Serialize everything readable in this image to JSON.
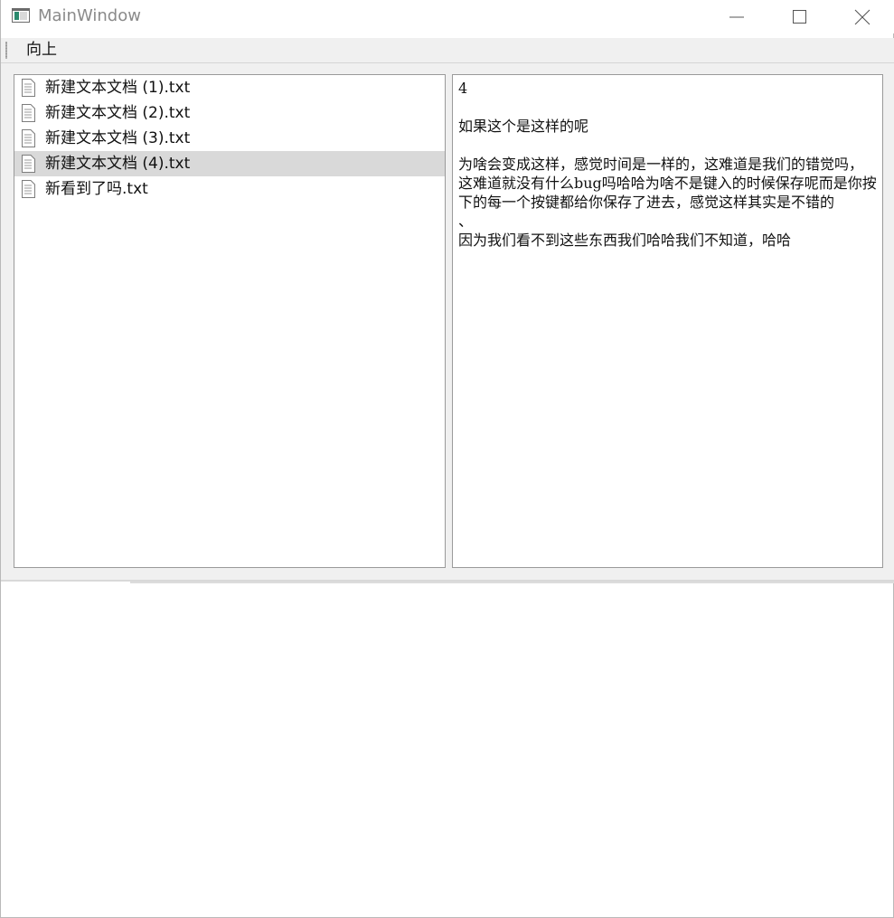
{
  "window": {
    "title": "MainWindow",
    "icons": {
      "app": "app-window-icon",
      "minimize": "minimize-icon",
      "maximize": "maximize-icon",
      "close": "close-icon"
    }
  },
  "toolbar": {
    "up_label": "向上"
  },
  "file_list": {
    "items": [
      {
        "label": "新建文本文档 (1).txt",
        "selected": false
      },
      {
        "label": "新建文本文档 (2).txt",
        "selected": false
      },
      {
        "label": "新建文本文档 (3).txt",
        "selected": false
      },
      {
        "label": "新建文本文档 (4).txt",
        "selected": true
      },
      {
        "label": "新看到了吗.txt",
        "selected": false
      }
    ],
    "item_icon": "text-file-icon"
  },
  "text_view": {
    "lines": [
      "4",
      "",
      "如果这个是这样的呢",
      "",
      "为啥会变成这样，感觉时间是一样的，这难道是我们的错觉吗，这难道就没有什么bug吗哈哈为啥不是键入的时候保存呢而是你按下的每一个按键都给你保存了进去，感觉这样其实是不错的",
      "、",
      "因为我们看不到这些东西我们哈哈我们不知道，哈哈"
    ]
  },
  "colors": {
    "selection": "#d9d9d9",
    "panel_background": "#f0f0f0",
    "border": "#9a9a9a",
    "title_text": "#8a8a8a"
  }
}
